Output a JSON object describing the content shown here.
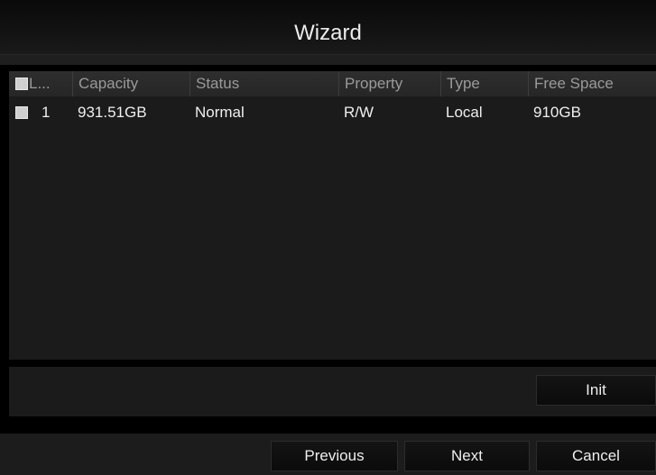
{
  "window": {
    "title": "Wizard"
  },
  "table": {
    "columns": [
      {
        "key": "no",
        "label": "L..."
      },
      {
        "key": "capacity",
        "label": "Capacity"
      },
      {
        "key": "status",
        "label": "Status"
      },
      {
        "key": "property",
        "label": "Property"
      },
      {
        "key": "type",
        "label": "Type"
      },
      {
        "key": "free_space",
        "label": "Free Space"
      }
    ],
    "rows": [
      {
        "checked": false,
        "no": "1",
        "capacity": "931.51GB",
        "status": "Normal",
        "property": "R/W",
        "type": "Local",
        "free_space": "910GB"
      }
    ]
  },
  "actions": {
    "init_label": "Init"
  },
  "footer": {
    "previous_label": "Previous",
    "next_label": "Next",
    "cancel_label": "Cancel"
  },
  "colors": {
    "background": "#000000",
    "panel": "#1b1b1b",
    "header": "#2a2a2a",
    "text": "#efefef",
    "header_text": "#9a9a9a"
  }
}
